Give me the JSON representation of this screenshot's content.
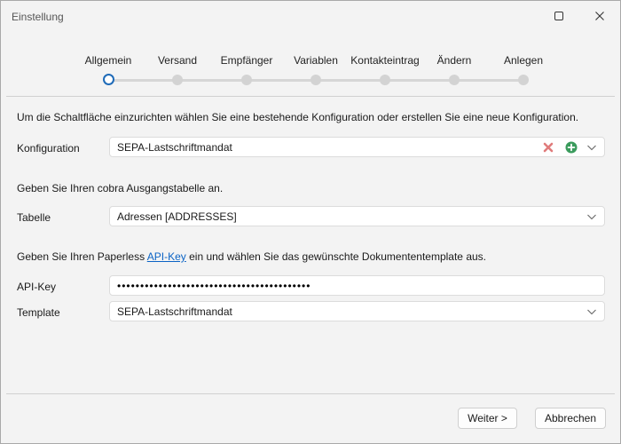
{
  "window": {
    "title": "Einstellung"
  },
  "stepper": {
    "steps": [
      {
        "label": "Allgemein"
      },
      {
        "label": "Versand"
      },
      {
        "label": "Empfänger"
      },
      {
        "label": "Variablen"
      },
      {
        "label": "Kontakteintrag"
      },
      {
        "label": "Ändern"
      },
      {
        "label": "Anlegen"
      }
    ],
    "active_index": 0
  },
  "intro_text": "Um die Schaltfläche einzurichten wählen Sie eine bestehende Konfiguration oder erstellen Sie eine neue Konfiguration.",
  "konfiguration": {
    "label": "Konfiguration",
    "value": "SEPA-Lastschriftmandat",
    "delete_icon_color": "#e07b7b",
    "add_icon_color": "#3a9b5c"
  },
  "table_text": "Geben Sie Ihren cobra Ausgangstabelle an.",
  "tabelle": {
    "label": "Tabelle",
    "value": "Adressen [ADDRESSES]"
  },
  "paperless_text": {
    "before": "Geben Sie Ihren Paperless ",
    "link": "API-Key",
    "after": " ein und wählen Sie das gewünschte Dokumententemplate aus."
  },
  "api_key": {
    "label": "API-Key",
    "value": "••••••••••••••••••••••••••••••••••••••••••"
  },
  "template": {
    "label": "Template",
    "value": "SEPA-Lastschriftmandat"
  },
  "buttons": {
    "next": "Weiter >",
    "cancel": "Abbrechen"
  },
  "colors": {
    "accent": "#1f6bb8",
    "link": "#0b63c5"
  }
}
